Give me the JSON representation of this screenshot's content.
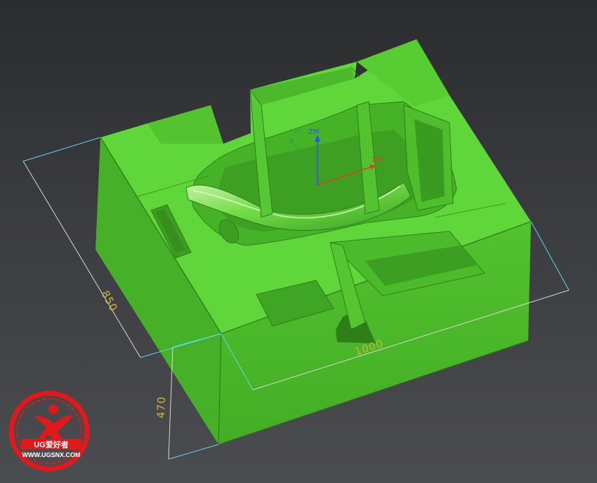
{
  "viewport": {
    "background_top": "#2b2c2e",
    "background_bottom": "#4b4c4f"
  },
  "model": {
    "body_color": "#5fd63a",
    "shade_color": "#3fa524",
    "dark_color": "#2f7f18",
    "highlight_color": "#86ea5e"
  },
  "dimensions": {
    "width_label": "850",
    "length_label": "1000",
    "height_label": "470",
    "line_colors": [
      "#5fd9ee",
      "#d8d8d8"
    ]
  },
  "csys": {
    "x_label": "XM",
    "y_label": "YM",
    "z_label": "ZM",
    "x_color": "#e53a2a",
    "y_color": "#2ea84a",
    "z_color": "#2a56e5"
  },
  "watermark": {
    "brand": "UG爱好者",
    "url": "WWW.UGSNX.COM",
    "color": "#e0191b"
  }
}
